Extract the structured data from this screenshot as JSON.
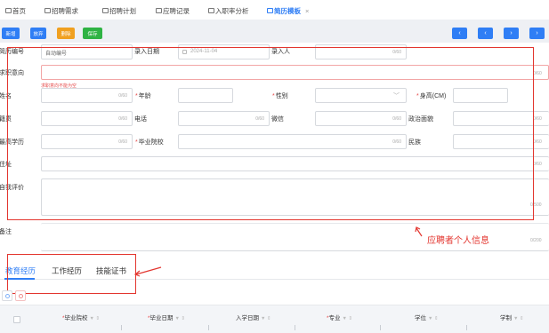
{
  "tabs": [
    {
      "label": "首页",
      "active": false
    },
    {
      "label": "招聘需求",
      "active": false
    },
    {
      "label": "招聘计划",
      "active": false
    },
    {
      "label": "应聘记录",
      "active": false
    },
    {
      "label": "入职率分析",
      "active": false
    },
    {
      "label": "简历模板",
      "active": true
    }
  ],
  "tab_close": "×",
  "toolbar": {
    "new_label": "新增",
    "discard_label": "放弃",
    "delete_label": "删除",
    "save_label": "保存",
    "nav": [
      "‹",
      "‹",
      "›",
      "›"
    ]
  },
  "form": {
    "resume_no_label": "简历编号",
    "resume_no_value": "自动编号",
    "entry_date_label": "录入日期",
    "entry_date_value": "2024-11-04",
    "entry_person_label": "录入人",
    "entry_person_count": "0/60",
    "intent_label": "求职意向",
    "intent_count": "0/60",
    "intent_error": "求职意向不能为空",
    "name_label": "姓名",
    "name_count": "0/60",
    "age_label": "年龄",
    "gender_label": "性别",
    "height_label": "身高(CM)",
    "native_label": "籍贯",
    "native_count": "0/60",
    "phone_label": "电话",
    "phone_count": "0/60",
    "wechat_label": "微信",
    "wechat_count": "0/60",
    "political_label": "政治面貌",
    "political_count": "0/60",
    "education_label": "最高学历",
    "education_count": "0/60",
    "school_label": "毕业院校",
    "school_count": "0/60",
    "ethnic_label": "民族",
    "ethnic_count": "0/60",
    "address_label": "住址",
    "address_count": "0/60",
    "self_eval_label": "自我评价",
    "self_eval_count": "0/500",
    "remark_label": "备注",
    "remark_count": "0/200"
  },
  "annotation": {
    "text": "应聘者个人信息"
  },
  "detail_tabs": [
    {
      "label": "教育经历",
      "active": true
    },
    {
      "label": "工作经历",
      "active": false
    },
    {
      "label": "技能证书",
      "active": false
    }
  ],
  "table": {
    "columns": [
      {
        "label": "毕业院校",
        "required": true
      },
      {
        "label": "毕业日期",
        "required": true
      },
      {
        "label": "入学日期",
        "required": false
      },
      {
        "label": "专业",
        "required": true
      },
      {
        "label": "学位",
        "required": false
      },
      {
        "label": "学制",
        "required": false
      }
    ],
    "required_mark": "*",
    "sort_glyph": "▼ ⇕"
  },
  "colors": {
    "primary": "#2f7ef5",
    "success": "#2fb344",
    "warning": "#f0a020",
    "danger": "#e3362f"
  }
}
